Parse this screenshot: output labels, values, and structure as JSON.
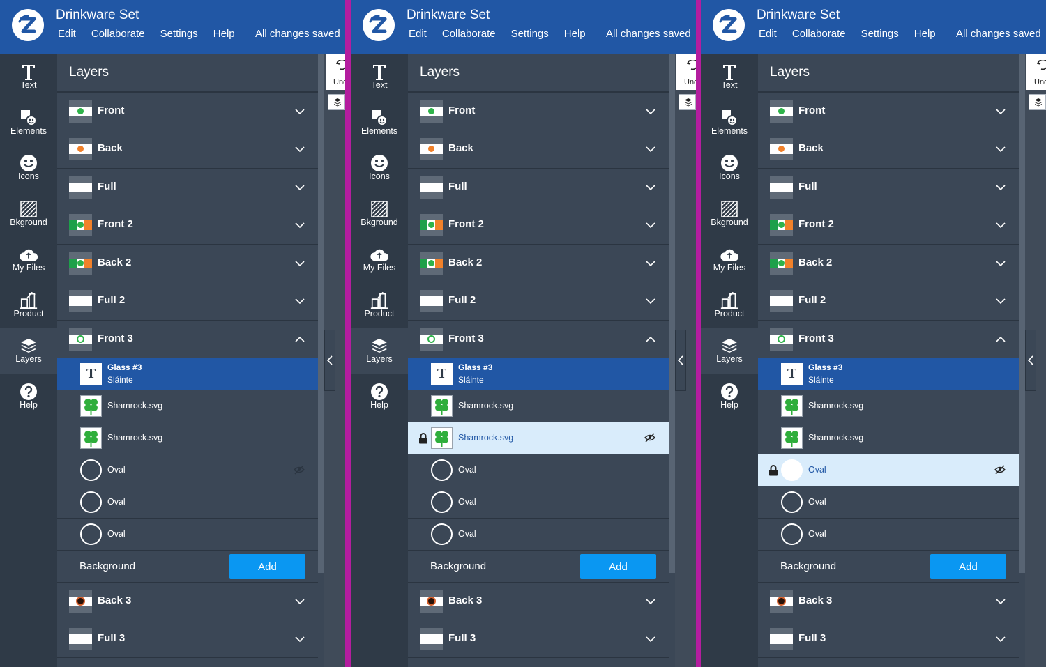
{
  "colors": {
    "topbar": "#2157a5",
    "divider": "#b41d9f",
    "selected_blue": "#2157a5",
    "selected_light": "#d9ecfb",
    "add_button": "#0a97f2"
  },
  "header": {
    "title": "Drinkware Set",
    "menu": [
      "Edit",
      "Collaborate",
      "Settings",
      "Help"
    ],
    "status": "All changes saved"
  },
  "sidebar": [
    {
      "label": "Text",
      "icon": "text-icon"
    },
    {
      "label": "Elements",
      "icon": "elements-icon"
    },
    {
      "label": "Icons",
      "icon": "smiley-icon"
    },
    {
      "label": "Bkground",
      "icon": "background-pattern-icon"
    },
    {
      "label": "My Files",
      "icon": "cloud-upload-icon"
    },
    {
      "label": "Product",
      "icon": "product-icon"
    },
    {
      "label": "Layers",
      "icon": "layers-icon"
    },
    {
      "label": "Help",
      "icon": "help-icon"
    }
  ],
  "layers": {
    "title": "Layers",
    "groups_top": [
      {
        "label": "Front",
        "thumb": "green"
      },
      {
        "label": "Back",
        "thumb": "orange"
      },
      {
        "label": "Full",
        "thumb": "white"
      },
      {
        "label": "Front 2",
        "thumb": "flag"
      },
      {
        "label": "Back 2",
        "thumb": "flag"
      },
      {
        "label": "Full 2",
        "thumb": "white"
      },
      {
        "label": "Front 3",
        "thumb": "ring",
        "expanded": true
      }
    ],
    "front3_children": [
      {
        "type": "text",
        "line1": "Glass #3",
        "line2": "Sláinte"
      },
      {
        "type": "shamrock",
        "label": "Shamrock.svg"
      },
      {
        "type": "shamrock",
        "label": "Shamrock.svg"
      },
      {
        "type": "oval",
        "label": "Oval"
      },
      {
        "type": "oval",
        "label": "Oval"
      },
      {
        "type": "oval",
        "label": "Oval"
      }
    ],
    "background": {
      "label": "Background",
      "button": "Add"
    },
    "groups_bottom": [
      {
        "label": "Back 3",
        "thumb": "dark"
      },
      {
        "label": "Full 3",
        "thumb": "white"
      }
    ]
  },
  "canvas": {
    "undo_label": "Undo"
  },
  "panels": [
    {
      "selected_light_index": -1,
      "eye_index": 3
    },
    {
      "selected_light_index": 2,
      "eye_index": 2
    },
    {
      "selected_light_index": 3,
      "eye_index": 3
    }
  ]
}
